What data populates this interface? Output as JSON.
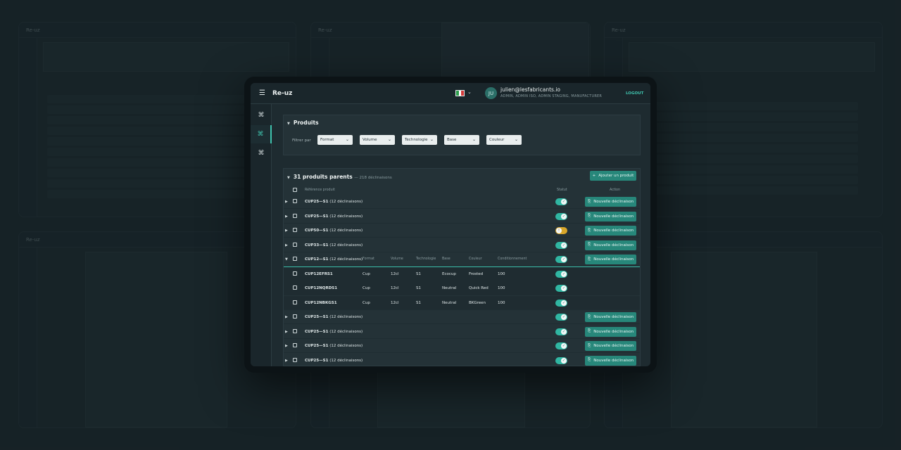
{
  "app": {
    "name": "Re-uz"
  },
  "user": {
    "email": "julien@lesfabricants.io",
    "roles": "ADMIN, ADMIN ISO, ADMIN STAGING, MANUFACTURER",
    "initials": "JU"
  },
  "header": {
    "logout_label": "LOGOUT"
  },
  "products_panel": {
    "title": "Produits",
    "filter_label": "Filtrer par",
    "filters": [
      "Format",
      "Volume",
      "Technologie",
      "Base",
      "Couleur"
    ]
  },
  "list": {
    "title": "31 produits parents",
    "count": "— 218 déclinaisons",
    "add_label": "Ajouter un produit",
    "columns": {
      "ref": "Référence produit",
      "statut": "Statut",
      "action": "Action"
    },
    "sub_columns": [
      "Format",
      "Volume",
      "Technologie",
      "Base",
      "Couleur",
      "Conditionnement"
    ],
    "new_variant_label": "Nouvelle déclinaison",
    "parents_before": [
      {
        "ref": "CUP25—S1",
        "count": "(12 déclinaisons)",
        "status": "on"
      },
      {
        "ref": "CUP25—S1",
        "count": "(12 déclinaisons)",
        "status": "on"
      },
      {
        "ref": "CUP50—S1",
        "count": "(12 déclinaisons)",
        "status": "warn"
      },
      {
        "ref": "CUP33—S1",
        "count": "(12 déclinaisons)",
        "status": "on"
      }
    ],
    "expanded": {
      "ref": "CUP12—S1",
      "count": "(12 déclinaisons)",
      "status": "on"
    },
    "children": [
      {
        "ref": "CUP12EFRS1",
        "format": "Cup",
        "volume": "12cl",
        "techno": "S1",
        "base": "Ecocup",
        "couleur": "Frosted",
        "cond": "100"
      },
      {
        "ref": "CUP12NQRDS1",
        "format": "Cup",
        "volume": "12cl",
        "techno": "S1",
        "base": "Neutral",
        "couleur": "Quick Red",
        "cond": "100"
      },
      {
        "ref": "CUP12NBKGS1",
        "format": "Cup",
        "volume": "12cl",
        "techno": "S1",
        "base": "Neutral",
        "couleur": "BKGreen",
        "cond": "100"
      }
    ],
    "parents_after": [
      {
        "ref": "CUP25—S1",
        "count": "(12 déclinaisons)",
        "status": "on"
      },
      {
        "ref": "CUP25—S1",
        "count": "(12 déclinaisons)",
        "status": "on"
      },
      {
        "ref": "CUP25—S1",
        "count": "(12 déclinaisons)",
        "status": "on"
      },
      {
        "ref": "CUP25—S1",
        "count": "(12 déclinaisons)",
        "status": "on"
      }
    ]
  },
  "colors": {
    "accent": "#27877a",
    "toggle_on": "#30b6a2",
    "toggle_warn": "#d8a62a",
    "flag": [
      "#2a9d4a",
      "#ffffff",
      "#d43a3a"
    ]
  },
  "icons": {
    "menu": "hamburger-icon",
    "nav": [
      "grid-icon",
      "grid-icon",
      "grid-icon"
    ],
    "plus": "plus-icon",
    "check": "check-icon"
  }
}
